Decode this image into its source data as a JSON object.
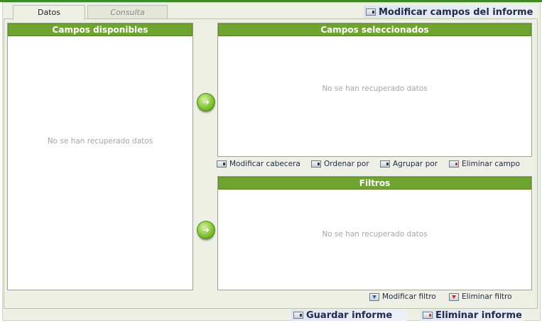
{
  "tabs": [
    {
      "label": "Datos"
    },
    {
      "label": "Consulta"
    }
  ],
  "top_action": {
    "label": "Modificar campos del informe",
    "icon": "report-icon"
  },
  "available_fields": {
    "title": "Campos disponibles",
    "empty_text": "No se han recuperado datos"
  },
  "selected_fields": {
    "title": "Campos seleccionados",
    "empty_text": "No se han recuperado datos"
  },
  "field_actions": [
    {
      "label": "Modificar cabecera",
      "icon": "header-icon"
    },
    {
      "label": "Ordenar por",
      "icon": "sort-icon"
    },
    {
      "label": "Agrupar por",
      "icon": "group-icon"
    },
    {
      "label": "Eliminar campo",
      "icon": "delete-field-icon"
    }
  ],
  "filters": {
    "title": "Filtros",
    "empty_text": "No se han recuperado datos"
  },
  "filter_actions": [
    {
      "label": "Modificar filtro",
      "icon": "filter-icon"
    },
    {
      "label": "Eliminar filtro",
      "icon": "delete-filter-icon"
    }
  ],
  "footer": {
    "save_label": "Guardar informe",
    "delete_label": "Eliminar informe"
  },
  "colors": {
    "header_green": "#6fa52f",
    "top_border": "#3d8a27",
    "panel_bg": "#eef0e6"
  },
  "arrows": {
    "glyph": "➜"
  }
}
